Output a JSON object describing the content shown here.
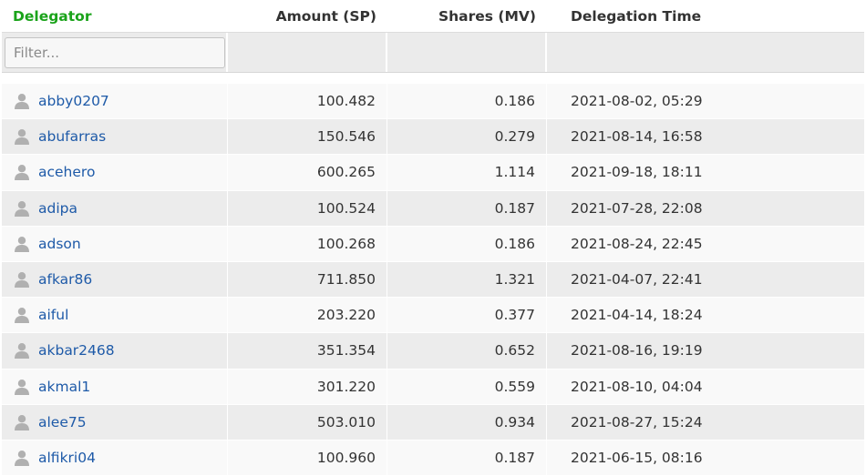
{
  "table": {
    "headers": {
      "delegator": "Delegator",
      "amount": "Amount (SP)",
      "shares": "Shares (MV)",
      "time": "Delegation Time"
    },
    "filter": {
      "placeholder": "Filter..."
    },
    "rows": [
      {
        "user": "abby0207",
        "amount": "100.482",
        "shares": "0.186",
        "time": "2021-08-02, 05:29"
      },
      {
        "user": "abufarras",
        "amount": "150.546",
        "shares": "0.279",
        "time": "2021-08-14, 16:58"
      },
      {
        "user": "acehero",
        "amount": "600.265",
        "shares": "1.114",
        "time": "2021-09-18, 18:11"
      },
      {
        "user": "adipa",
        "amount": "100.524",
        "shares": "0.187",
        "time": "2021-07-28, 22:08"
      },
      {
        "user": "adson",
        "amount": "100.268",
        "shares": "0.186",
        "time": "2021-08-24, 22:45"
      },
      {
        "user": "afkar86",
        "amount": "711.850",
        "shares": "1.321",
        "time": "2021-04-07, 22:41"
      },
      {
        "user": "aiful",
        "amount": "203.220",
        "shares": "0.377",
        "time": "2021-04-14, 18:24"
      },
      {
        "user": "akbar2468",
        "amount": "351.354",
        "shares": "0.652",
        "time": "2021-08-16, 19:19"
      },
      {
        "user": "akmal1",
        "amount": "301.220",
        "shares": "0.559",
        "time": "2021-08-10, 04:04"
      },
      {
        "user": "alee75",
        "amount": "503.010",
        "shares": "0.934",
        "time": "2021-08-27, 15:24"
      },
      {
        "user": "alfikri04",
        "amount": "100.960",
        "shares": "0.187",
        "time": "2021-06-15, 08:16"
      }
    ]
  },
  "colors": {
    "active_header": "#1aa31a",
    "link": "#1e5aa8",
    "row_odd": "#f9f9f9",
    "row_even": "#ececec",
    "user_icon": "#b0b0b0"
  },
  "icons": {
    "user": "user-avatar-icon"
  }
}
